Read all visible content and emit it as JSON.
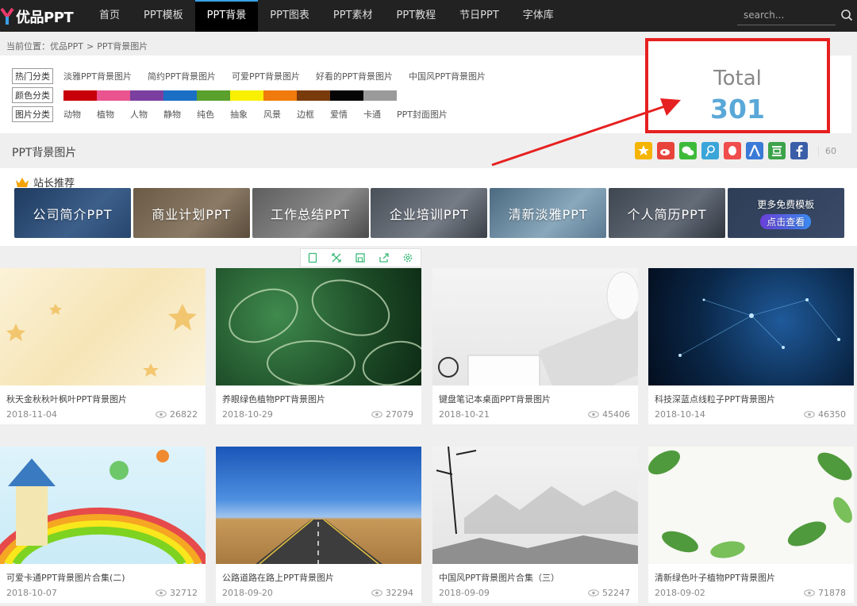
{
  "brand": {
    "name": "优品PPT"
  },
  "nav": {
    "items": [
      {
        "label": "首页"
      },
      {
        "label": "PPT模板"
      },
      {
        "label": "PPT背景"
      },
      {
        "label": "PPT图表"
      },
      {
        "label": "PPT素材"
      },
      {
        "label": "PPT教程"
      },
      {
        "label": "节日PPT"
      },
      {
        "label": "字体库"
      }
    ],
    "active_index": 2,
    "search_placeholder": "search..."
  },
  "breadcrumb": {
    "prefix": "当前位置：",
    "home": "优品PPT",
    "sep": ">",
    "current": "PPT背景图片"
  },
  "filters": {
    "hot": {
      "label": "热门分类",
      "links": [
        "淡雅PPT背景图片",
        "简约PPT背景图片",
        "可爱PPT背景图片",
        "好看的PPT背景图片",
        "中国风PPT背景图片"
      ]
    },
    "color": {
      "label": "颜色分类",
      "swatches": [
        "#c8000a",
        "#e9548e",
        "#7b3fa0",
        "#1a6fc4",
        "#5aa02c",
        "#f8f000",
        "#f07a0c",
        "#7a3b0c",
        "#050505",
        "#9a9a9a"
      ]
    },
    "type": {
      "label": "图片分类",
      "links": [
        "动物",
        "植物",
        "人物",
        "静物",
        "纯色",
        "抽象",
        "风景",
        "边框",
        "爱情",
        "卡通",
        "PPT封面图片"
      ]
    }
  },
  "annotation": {
    "label": "Total",
    "value": "301",
    "color": "#e62020"
  },
  "section": {
    "title": "PPT背景图片",
    "share_count": "60"
  },
  "shares": [
    {
      "icon": "qzone-icon",
      "color": "#f5b400"
    },
    {
      "icon": "weibo-icon",
      "color": "#e8433a"
    },
    {
      "icon": "wechat-icon",
      "color": "#3dba3a"
    },
    {
      "icon": "tencent-weibo-icon",
      "color": "#3aa5d8"
    },
    {
      "icon": "qq-icon",
      "color": "#f04d4d"
    },
    {
      "icon": "renren-icon",
      "color": "#3b7ad6"
    },
    {
      "icon": "douban-icon",
      "color": "#3da34b"
    },
    {
      "icon": "facebook-icon",
      "color": "#3b5ea8"
    }
  ],
  "recommend": {
    "title": "站长推荐",
    "items": [
      {
        "label": "公司简介PPT"
      },
      {
        "label": "商业计划PPT"
      },
      {
        "label": "工作总结PPT"
      },
      {
        "label": "企业培训PPT"
      },
      {
        "label": "清新淡雅PPT"
      },
      {
        "label": "个人简历PPT"
      }
    ],
    "more": {
      "title": "更多免费模板",
      "button": "点击查看"
    }
  },
  "tools": [
    "tablet-icon",
    "fullscreen-icon",
    "save-icon",
    "share-icon",
    "settings-icon"
  ],
  "cards": [
    {
      "title": "秋天金秋秋叶枫叶PPT背景图片",
      "date": "2018-11-04",
      "views": "26822"
    },
    {
      "title": "养眼绿色植物PPT背景图片",
      "date": "2018-10-29",
      "views": "27079"
    },
    {
      "title": "键盘笔记本桌面PPT背景图片",
      "date": "2018-10-21",
      "views": "45406"
    },
    {
      "title": "科技深蓝点线粒子PPT背景图片",
      "date": "2018-10-14",
      "views": "46350"
    },
    {
      "title": "可爱卡通PPT背景图片合集(二)",
      "date": "2018-10-07",
      "views": "32712"
    },
    {
      "title": "公路道路在路上PPT背景图片",
      "date": "2018-09-20",
      "views": "32294"
    },
    {
      "title": "中国风PPT背景图片合集（三）",
      "date": "2018-09-09",
      "views": "52247"
    },
    {
      "title": "清新绿色叶子植物PPT背景图片",
      "date": "2018-09-02",
      "views": "71878"
    }
  ]
}
